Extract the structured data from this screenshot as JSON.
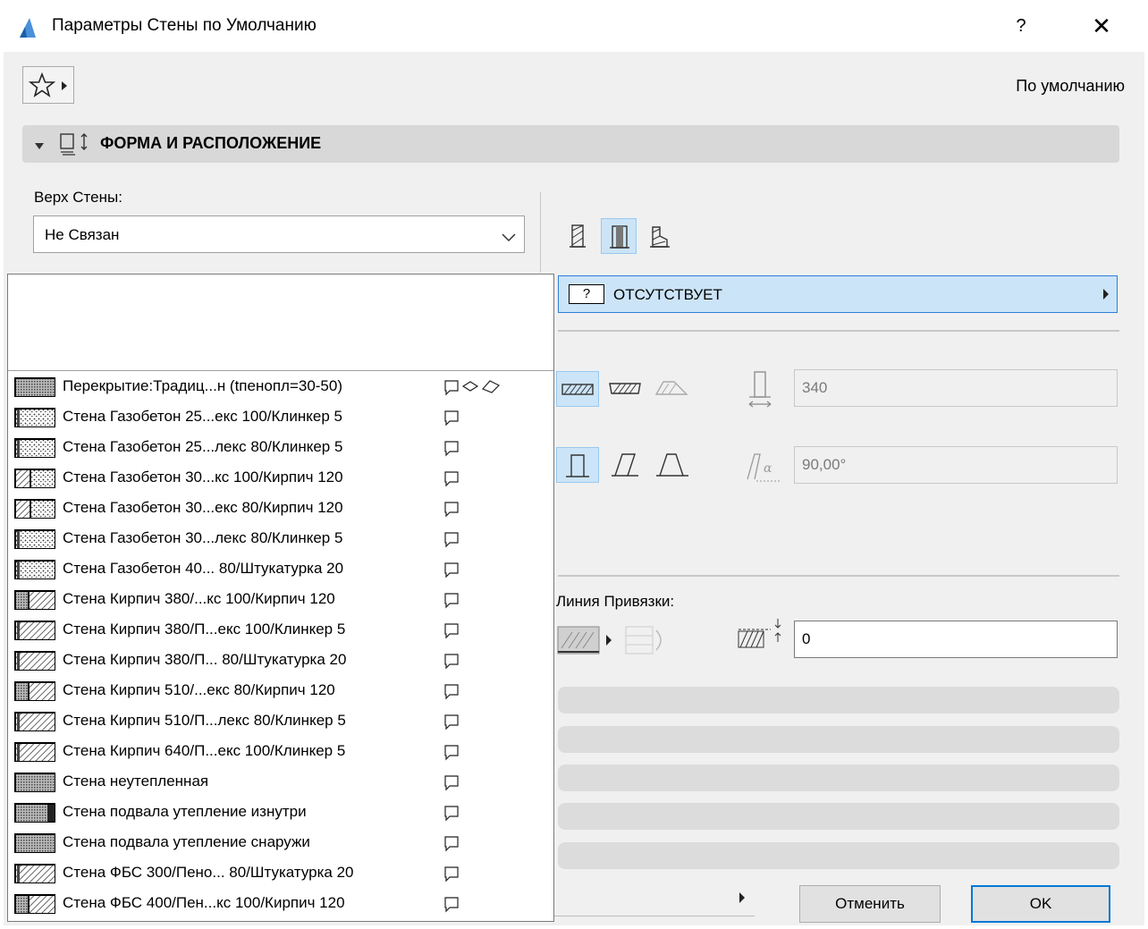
{
  "window": {
    "title": "Параметры Стены по Умолчанию",
    "help_label": "?",
    "close_label": "✕"
  },
  "toolbar": {
    "favorites_icon": "star-icon",
    "default_label": "По умолчанию"
  },
  "section": {
    "title": "ФОРМА И РАСПОЛОЖЕНИЕ",
    "icon": "geometry-section-icon"
  },
  "top_link": {
    "label": "Верх Стены:",
    "value": "Не Связан"
  },
  "composite": {
    "badge": "?",
    "value": "ОТСУТСТВУЕТ"
  },
  "thickness": {
    "value": "340"
  },
  "slant": {
    "value": "90,00°"
  },
  "reference_line": {
    "label": "Линия Привязки:",
    "offset_value": "0"
  },
  "buttons": {
    "cancel": "Отменить",
    "ok": "OK"
  },
  "dropdown": {
    "items": [
      {
        "label": "Перекрытие:Традиц...н (tпенопл=30-50)",
        "pattern": "dense",
        "multi_icon": true
      },
      {
        "label": "Стена Газобетон 25...екс 100/Клинкер 5",
        "pattern": "dots"
      },
      {
        "label": "Стена Газобетон 25...лекс 80/Клинкер 5",
        "pattern": "dots"
      },
      {
        "label": "Стена Газобетон 30...кс 100/Кирпич 120",
        "pattern": "dots-hatch"
      },
      {
        "label": "Стена Газобетон 30...екс 80/Кирпич 120",
        "pattern": "dots-hatch"
      },
      {
        "label": "Стена Газобетон 30...лекс 80/Клинкер 5",
        "pattern": "dots"
      },
      {
        "label": "Стена Газобетон 40... 80/Штукатурка 20",
        "pattern": "dots"
      },
      {
        "label": "Стена Кирпич 380/...кс 100/Кирпич 120",
        "pattern": "hatch-dark"
      },
      {
        "label": "Стена Кирпич 380/П...екс 100/Клинкер 5",
        "pattern": "hatch"
      },
      {
        "label": "Стена Кирпич 380/П... 80/Штукатурка 20",
        "pattern": "hatch"
      },
      {
        "label": "Стена Кирпич 510/...екс 80/Кирпич 120",
        "pattern": "hatch-dark"
      },
      {
        "label": "Стена Кирпич 510/П...лекс 80/Клинкер 5",
        "pattern": "hatch"
      },
      {
        "label": "Стена Кирпич 640/П...екс 100/Клинкер 5",
        "pattern": "hatch"
      },
      {
        "label": "Стена неутепленная",
        "pattern": "dense"
      },
      {
        "label": "Стена подвала утепление изнутри",
        "pattern": "dense-dark"
      },
      {
        "label": "Стена подвала утепление снаружи",
        "pattern": "dense"
      },
      {
        "label": "Стена ФБС 300/Пено... 80/Штукатурка 20",
        "pattern": "hatch"
      },
      {
        "label": "Стена ФБС 400/Пен...кс 100/Кирпич 120",
        "pattern": "hatch-dark"
      }
    ]
  },
  "colors": {
    "selected_bg": "#cce4f7",
    "accent": "#0078d7",
    "panel": "#f0f0f0"
  }
}
